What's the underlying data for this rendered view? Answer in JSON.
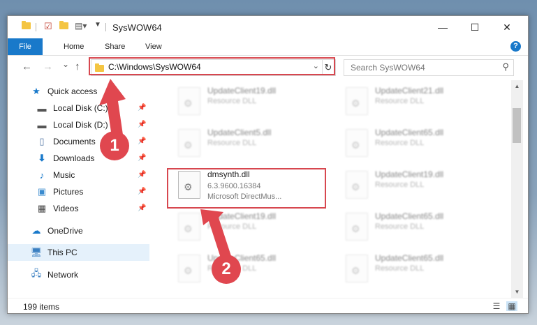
{
  "window": {
    "title": "SysWOW64",
    "controls": {
      "minimize": "—",
      "maximize": "☐",
      "close": "✕"
    }
  },
  "ribbon": {
    "tabs": [
      "File",
      "Home",
      "Share",
      "View"
    ],
    "help": "?"
  },
  "navigation": {
    "back": "←",
    "forward": "→",
    "recent": "⌄",
    "up": "↑",
    "address": "C:\\Windows\\SysWOW64",
    "refresh": "↻",
    "search_placeholder": "Search SysWOW64"
  },
  "sidebar": {
    "items": [
      {
        "label": "Quick access",
        "icon": "star-icon",
        "pinned": false
      },
      {
        "label": "Local Disk (C:)",
        "icon": "drive-icon",
        "pinned": true
      },
      {
        "label": "Local Disk (D:)",
        "icon": "drive-icon",
        "pinned": true
      },
      {
        "label": "Documents",
        "icon": "document-icon",
        "pinned": true
      },
      {
        "label": "Downloads",
        "icon": "download-icon",
        "pinned": true
      },
      {
        "label": "Music",
        "icon": "music-icon",
        "pinned": true
      },
      {
        "label": "Pictures",
        "icon": "pictures-icon",
        "pinned": true
      },
      {
        "label": "Videos",
        "icon": "video-icon",
        "pinned": true
      },
      {
        "label": "OneDrive",
        "icon": "cloud-icon",
        "pinned": false
      },
      {
        "label": "This PC",
        "icon": "computer-icon",
        "pinned": false,
        "selected": true
      },
      {
        "label": "Network",
        "icon": "network-icon",
        "pinned": false
      }
    ]
  },
  "files": [
    {
      "name": "UpdateClient19.dll",
      "line1": "Resource DLL",
      "blurred": true
    },
    {
      "name": "UpdateClient21.dll",
      "line1": "Resource DLL",
      "blurred": true
    },
    {
      "name": "UpdateClient5.dll",
      "line1": "Resource DLL",
      "blurred": true
    },
    {
      "name": "UpdateClient65.dll",
      "line1": "Resource DLL",
      "blurred": true
    },
    {
      "name": "dmsynth.dll",
      "line1": "6.3.9600.16384",
      "line2": "Microsoft DirectMus...",
      "blurred": false
    },
    {
      "name": "UpdateClient19.dll",
      "line1": "Resource DLL",
      "blurred": true
    },
    {
      "name": "UpdateClient19.dll",
      "line1": "Resource DLL",
      "blurred": true
    },
    {
      "name": "UpdateClient65.dll",
      "line1": "Resource DLL",
      "blurred": true
    },
    {
      "name": "UpdateClient65.dll",
      "line1": "Resource DLL",
      "blurred": true
    },
    {
      "name": "UpdateClient65.dll",
      "line1": "Resource DLL",
      "blurred": true
    }
  ],
  "status": {
    "item_count": "199 items"
  },
  "annotations": {
    "marker1": "1",
    "marker2": "2",
    "color": "#e0474f"
  },
  "colors": {
    "file_tab": "#1979ca",
    "highlight": "#d7474f",
    "selection": "#e5f1fb"
  }
}
